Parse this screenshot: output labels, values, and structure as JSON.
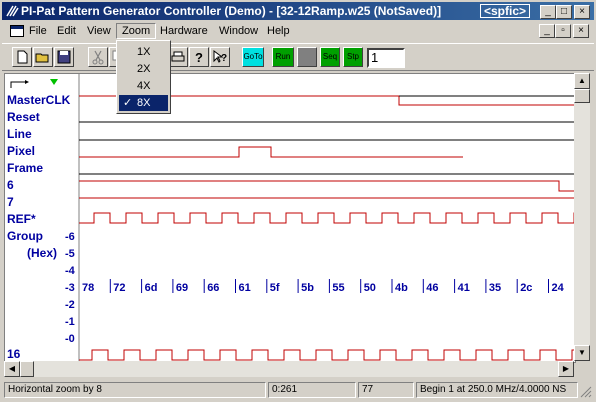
{
  "window": {
    "title": "PI-Pat Pattern Generator Controller (Demo) - [32-12Ramp.w25 (NotSaved)]",
    "tag": "<spfic>",
    "controls": [
      "_",
      "□",
      "×"
    ]
  },
  "menubar": {
    "items": [
      "File",
      "Edit",
      "View",
      "Zoom",
      "Hardware",
      "Window",
      "Help"
    ],
    "active": "Zoom",
    "mdi_controls": [
      "_",
      "▫",
      "×"
    ]
  },
  "zoom_menu": {
    "options": [
      "1X",
      "2X",
      "4X",
      "8X"
    ],
    "selected": "8X"
  },
  "toolbar": {
    "goto_label": "GoTo",
    "run_label": "Run",
    "seq_label": "Seq",
    "stp_label": "Stp",
    "step_value": "1"
  },
  "signals": {
    "labels": [
      "MasterCLK",
      "Reset",
      "Line",
      "Pixel",
      "Frame",
      "6",
      "7",
      "REF*",
      "Group",
      "(Hex)",
      "16"
    ],
    "group_axis": [
      "-6",
      "-5",
      "-4",
      "-3",
      "-2",
      "-1",
      "-0"
    ],
    "hex_values": [
      "78",
      "72",
      "6d",
      "69",
      "66",
      "61",
      "5f",
      "5b",
      "55",
      "50",
      "4b",
      "46",
      "41",
      "35",
      "2c",
      "24"
    ],
    "marker_colors": {
      "black": "#000000",
      "red": "#c00000",
      "green": "#00c000",
      "blue": "#0000a0"
    }
  },
  "status": {
    "message": "Horizontal zoom by 8",
    "position": "0:261",
    "value": "77",
    "info": "Begin 1 at 250.0 MHz/4.0000 NS"
  }
}
